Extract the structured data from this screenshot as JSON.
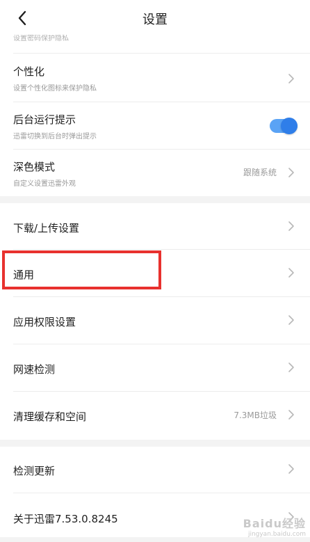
{
  "header": {
    "title": "设置",
    "clipped_subtitle": "设置密码保护隐私"
  },
  "section1": {
    "personalize": {
      "title": "个性化",
      "sub": "设置个性化图标来保护隐私"
    },
    "background": {
      "title": "后台运行提示",
      "sub": "迅雷切换到后台时弹出提示",
      "toggle_on": true
    },
    "dark_mode": {
      "title": "深色模式",
      "sub": "自定义设置迅雷外观",
      "value": "跟随系统"
    }
  },
  "section2": {
    "download": {
      "title": "下载/上传设置"
    },
    "general": {
      "title": "通用"
    },
    "permissions": {
      "title": "应用权限设置"
    },
    "speed": {
      "title": "网速检测"
    },
    "cache": {
      "title": "清理缓存和空间",
      "value": "7.3MB垃圾"
    }
  },
  "section3": {
    "update": {
      "title": "检测更新"
    },
    "about": {
      "title": "关于迅雷7.53.0.8245"
    }
  },
  "watermark": {
    "main": "Baidu经验",
    "sub": "jingyan.baidu.com"
  },
  "colors": {
    "toggle_track": "#5aa3f5",
    "toggle_knob": "#2f7ee9",
    "highlight_box": "#e8312e"
  }
}
